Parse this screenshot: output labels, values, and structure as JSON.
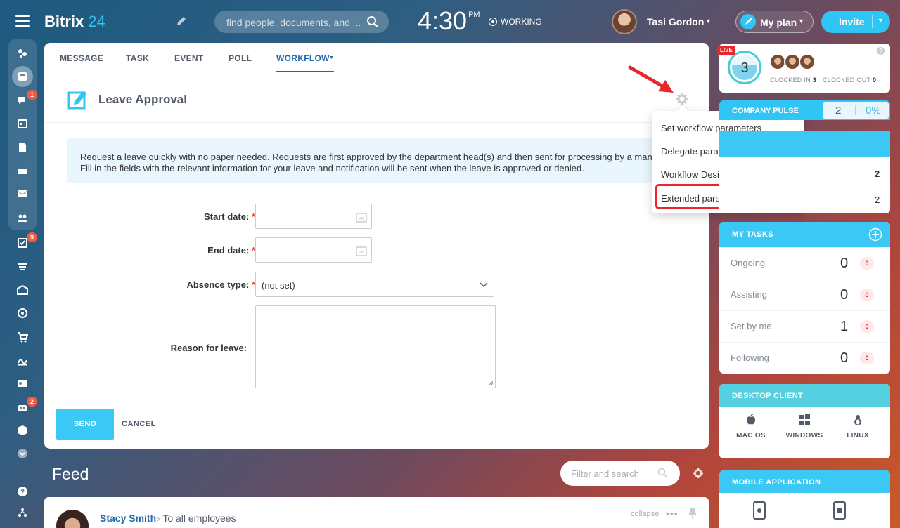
{
  "topbar": {
    "logo_main": "Bitrix",
    "logo_num": "24",
    "search_placeholder": "find people, documents, and ...",
    "time": "4:30",
    "ampm": "PM",
    "work_status": "WORKING",
    "user_name": "Tasi Gordon",
    "plan_label": "My plan",
    "invite_label": "Invite"
  },
  "sidebar": {
    "badges": {
      "chat": "1",
      "tasks": "9",
      "robots": "2"
    }
  },
  "composer": {
    "tabs": [
      {
        "label": "MESSAGE"
      },
      {
        "label": "TASK"
      },
      {
        "label": "EVENT"
      },
      {
        "label": "POLL"
      },
      {
        "label": "WORKFLOW"
      }
    ],
    "title": "Leave Approval",
    "info_text": "Request a leave quickly with no paper needed. Requests are first approved by the department head(s) and then sent for processing by a manager. Fill in the fields with the relevant information for your leave and notification will be sent when the leave is approved or denied.",
    "fields": {
      "start_label": "Start date:",
      "end_label": "End date:",
      "absence_label": "Absence type:",
      "absence_value": "(not set)",
      "reason_label": "Reason for leave:",
      "required_mark": "*"
    },
    "send_label": "SEND",
    "cancel_label": "CANCEL"
  },
  "settings_menu": {
    "items": [
      {
        "label": "Set workflow parameters"
      },
      {
        "label": "Delegate parameter configuration"
      },
      {
        "label": "Workflow Designer"
      },
      {
        "label": "Extended parameters"
      }
    ],
    "highlight_color": "#e8262b"
  },
  "timeman": {
    "live": "LIVE",
    "count": "3",
    "clocked_in_label": "CLOCKED IN",
    "clocked_in": "3",
    "clocked_out_label": "CLOCKED OUT",
    "clocked_out": "0",
    "help": "?"
  },
  "pulse": {
    "title": "COMPANY PULSE",
    "value": "2",
    "percent": "0%"
  },
  "partial_widget": {
    "row1_count": "2",
    "row2_count": "2"
  },
  "my_tasks": {
    "title": "MY TASKS",
    "rows": [
      {
        "label": "Ongoing",
        "count": "0",
        "badge": "0"
      },
      {
        "label": "Assisting",
        "count": "0",
        "badge": "0"
      },
      {
        "label": "Set by me",
        "count": "1",
        "badge": "0"
      },
      {
        "label": "Following",
        "count": "0",
        "badge": "0"
      }
    ]
  },
  "desktop_client": {
    "title": "DESKTOP CLIENT",
    "items": [
      {
        "label": "MAC OS"
      },
      {
        "label": "WINDOWS"
      },
      {
        "label": "LINUX"
      }
    ]
  },
  "mobile_app": {
    "title": "MOBILE APPLICATION"
  },
  "feed": {
    "title": "Feed",
    "filter_placeholder": "Filter and search",
    "post": {
      "author": "Stacy Smith",
      "recipients": "To all employees",
      "collapse": "collapse"
    }
  },
  "colors": {
    "accent": "#2fc6f6",
    "link": "#2067b0",
    "tasks_header": "#3bc8f5",
    "desktop_header": "#55d0e0"
  }
}
